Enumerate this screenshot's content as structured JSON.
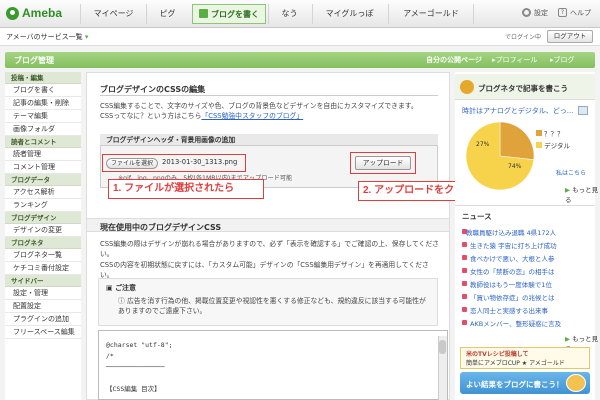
{
  "brand": {
    "name": "Ameba"
  },
  "nav": {
    "tabs": [
      "マイページ",
      "ピグ",
      "ブログを書く",
      "なう",
      "マイグルっぽ",
      "アメーゴールド"
    ],
    "settings": "設定",
    "help": "ヘルプ"
  },
  "subbar": {
    "services": "アメーバのサービス一覧",
    "logged_in": "でログイン中",
    "logout": "ログアウト"
  },
  "header": {
    "title": "ブログ管理",
    "links": [
      "自分の公開ページ",
      "プロフィール",
      "ブログ"
    ]
  },
  "sidebar": {
    "groups": [
      {
        "label": "投稿・編集",
        "items": [
          "ブログを書く",
          "記事の編集・削除",
          "テーマ編集",
          "画像フォルダ"
        ]
      },
      {
        "label": "読者とコメント",
        "items": [
          "読者管理",
          "コメント管理"
        ]
      },
      {
        "label": "ブログデータ",
        "items": [
          "アクセス解析",
          "ランキング"
        ]
      },
      {
        "label": "ブログデザイン",
        "items": [
          "デザインの変更"
        ]
      },
      {
        "label": "ブログネタ",
        "items": [
          "ブログネタ一覧",
          "ケチコミ番付設定"
        ]
      },
      {
        "label": "サイドバー",
        "items": [
          "設定・管理",
          "配置設定",
          "プラグインの追加",
          "フリースペース編集"
        ]
      }
    ]
  },
  "main": {
    "title": "ブログデザインのCSSの編集",
    "intro1": "CSS編集することで、文字のサイズや色、ブログの背景色などデザインを自由にカスタマイズできます。",
    "intro2_prefix": "CSSってなに？という方はこちら",
    "intro2_link": "「CSS勉強中スタッフのブログ」",
    "upload": {
      "heading": "ブログデザインヘッダ・背景用画像の追加",
      "choose_button": "ファイルを選択",
      "file_name": "2013-01-30_1313.png",
      "upload_button": "アップロード",
      "note": "※gif、jpg、pngのみ、5枚(各1MB以内)までアップロード可能"
    },
    "callouts": {
      "step1": "1. ファイルが選択されたら",
      "step2": "2. アップロードをクリック"
    },
    "current": {
      "heading": "現在使用中のブログデザインCSS",
      "text1": "CSS編集の際はデザインが崩れる場合がありますので、必ず「表示を確認する」でご確認の上、保存してください。",
      "text2": "CSSの内容を初期状態に戻すには、「カスタム可能」デザインの「CSS編集用デザイン」を再適用してください。"
    },
    "caution": {
      "title": "ご注意",
      "text": "広告を消す行為の他、掲載位置変更や視認性を悪くする修正なども、規約違反に該当する可能性がありますのでご遠慮下さい。"
    },
    "css_lines": [
      "@charset \"utf-8\";",
      "/*",
      "───────────────",
      "【CSS編集 目次】"
    ]
  },
  "right": {
    "neta_title": "ブログネタで記事を書こう",
    "neta_question": "時計はアナログとデジタル、どっ...",
    "legend": [
      "？？？",
      "デジタル"
    ],
    "pie": {
      "type": "pie",
      "values": [
        27,
        74
      ],
      "labels": [
        "27%",
        "74%"
      ],
      "colors": [
        "#f1c232",
        "#f6d34a"
      ]
    },
    "answer_link": "私はこちら",
    "more1": "もっと見る",
    "news_title": "ニュース",
    "news": [
      "教職員駆け込み退職 4県172人",
      "生きた猿 宇宙に打ち上げ成功",
      "食べかけで悪い、大根と人参",
      "女性の「禁断の恋」の相手は",
      "教師役はもう一度体験で1位",
      "「買い物依存症」の兆候とは",
      "恋人同士と実感する出来事",
      "AKBメンバー、整形疑惑に言及"
    ],
    "more2": "もっと見る",
    "banner1_line1": "米のTVレシピ投稿して",
    "banner1_line2": "簡単にアメブロCUP ★ アメゴールド",
    "banner2": "よい結果をブログに書こう！"
  }
}
